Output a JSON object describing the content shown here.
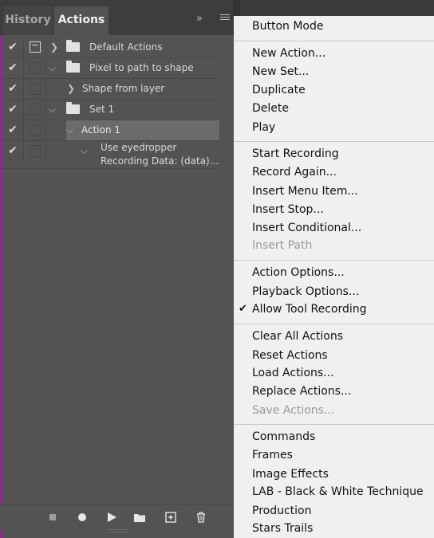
{
  "tabs": {
    "history": "History",
    "actions": "Actions",
    "more": "»"
  },
  "actions_rows": [
    {
      "label": "Default Actions"
    },
    {
      "label": "Pixel to path to shape"
    },
    {
      "label": "Shape from layer"
    },
    {
      "label": "Set 1"
    },
    {
      "label": "Action 1"
    },
    {
      "label": "Use eyedropper",
      "sub": "Recording Data: (data)..."
    }
  ],
  "menu": {
    "button_mode": "Button Mode",
    "new_action": "New Action...",
    "new_set": "New Set...",
    "duplicate": "Duplicate",
    "delete": "Delete",
    "play": "Play",
    "start_recording": "Start Recording",
    "record_again": "Record Again...",
    "insert_menu_item": "Insert Menu Item...",
    "insert_stop": "Insert Stop...",
    "insert_conditional": "Insert Conditional...",
    "insert_path": "Insert Path",
    "action_options": "Action Options...",
    "playback_options": "Playback Options...",
    "allow_tool_recording": "Allow Tool Recording",
    "clear_all_actions": "Clear All Actions",
    "reset_actions": "Reset Actions",
    "load_actions": "Load Actions...",
    "replace_actions": "Replace Actions...",
    "save_actions": "Save Actions...",
    "commands": "Commands",
    "frames": "Frames",
    "image_effects": "Image Effects",
    "lab_bw": "LAB - Black & White Technique",
    "production": "Production",
    "stars_trails": "Stars Trails"
  }
}
